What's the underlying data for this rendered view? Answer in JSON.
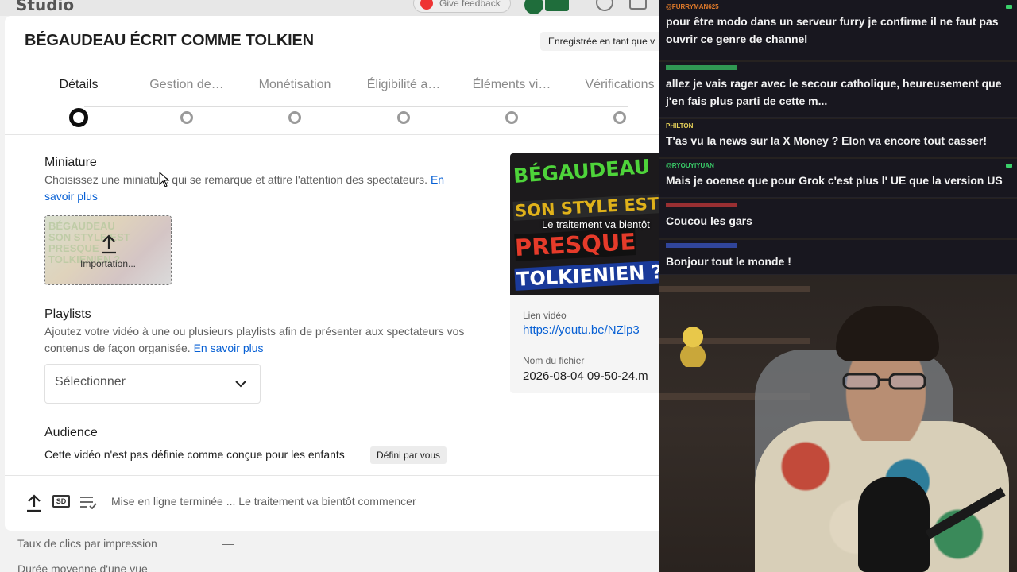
{
  "background": {
    "logo_text": "Studio",
    "feedback_label": "Give feedback",
    "metrics": [
      "Taux de clics par impression",
      "Durée moyenne d'une vue"
    ],
    "metric_values": [
      "—",
      "—"
    ]
  },
  "dialog": {
    "title": "BÉGAUDEAU ÉCRIT COMME TOLKIEN",
    "saved_chip": "Enregistrée en tant que v",
    "steps": [
      {
        "label": "Détails",
        "active": true
      },
      {
        "label": "Gestion de…",
        "active": false
      },
      {
        "label": "Monétisation",
        "active": false
      },
      {
        "label": "Éligibilité a…",
        "active": false
      },
      {
        "label": "Éléments vi…",
        "active": false
      },
      {
        "label": "Vérifications",
        "active": false
      }
    ],
    "thumbnail": {
      "title": "Miniature",
      "desc": "Choisissez une miniature qui se remarque et attire l'attention des spectateurs.",
      "link": "En savoir plus",
      "upload_label": "Importation..."
    },
    "playlists": {
      "title": "Playlists",
      "desc": "Ajoutez votre vidéo à une ou plusieurs playlists afin de présenter aux spectateurs vos contenus de façon organisée.",
      "link": "En savoir plus",
      "select_value": "Sélectionner"
    },
    "audience": {
      "title": "Audience",
      "text": "Cette vidéo n'est pas définie comme conçue pour les enfants",
      "chip": "Défini par vous"
    },
    "preview": {
      "thumb_lines": [
        "BÉGAUDEAU",
        "SON STYLE EST",
        "PRESQUE",
        "TOLKIENIEN ?"
      ],
      "overlay": "Le traitement va bientôt",
      "link_label": "Lien vidéo",
      "link": "https://youtu.be/NZlp3",
      "file_label": "Nom du fichier",
      "file": "2026-08-04 09-50-24.m"
    },
    "bottom": {
      "sd_label": "SD",
      "status": "Mise en ligne terminée ... Le traitement va bientôt commencer"
    }
  },
  "chat": [
    {
      "user": "@FURRYMAN625",
      "user_color": "#e07a2a",
      "text": "pour être modo dans un serveur furry je confirme il ne faut pas ouvrir ce genre de channel"
    },
    {
      "user": "",
      "user_color": "#3ad06a",
      "text": "allez je vais rager avec le secour catholique, heureusement que j'en fais plus parti de cette m..."
    },
    {
      "user": "PHILTON",
      "user_color": "#e8d35a",
      "text": "T'as vu la news sur la X Money ? Elon va encore tout casser!"
    },
    {
      "user": "@RYOUYIYUAN",
      "user_color": "#3ad06a",
      "text": "Mais je ooense que pour Grok c'est plus l' UE que la version US"
    },
    {
      "user": "",
      "user_color": "#d03a3a",
      "text": "Coucou les gars"
    },
    {
      "user": "",
      "user_color": "#3a5ad0",
      "text": "Bonjour tout le monde !"
    }
  ]
}
